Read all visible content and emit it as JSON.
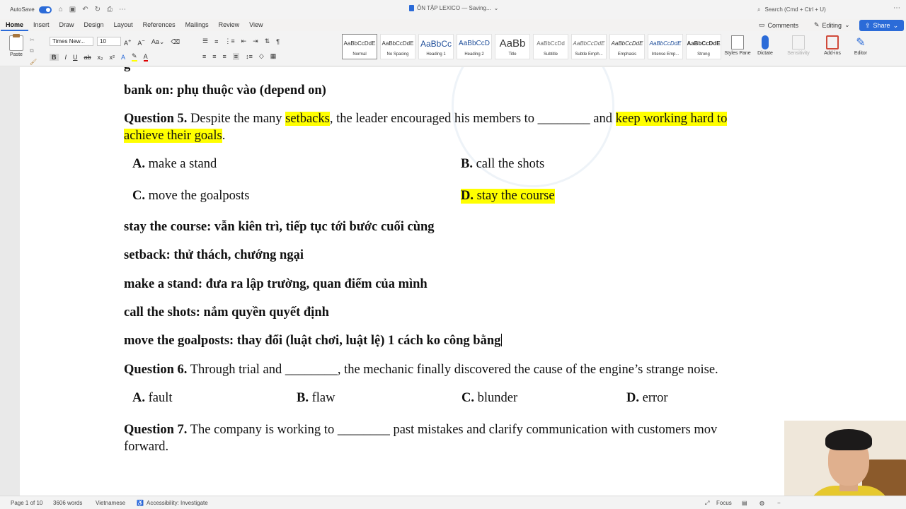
{
  "titlebar": {
    "autosave_label": "AutoSave",
    "document_title": "ÔN TẬP LEXICO — Saving...",
    "search_placeholder": "Search (Cmd + Ctrl + U)"
  },
  "ribbon_tabs": [
    "Home",
    "Insert",
    "Draw",
    "Design",
    "Layout",
    "References",
    "Mailings",
    "Review",
    "View"
  ],
  "ribbon_actions": {
    "comments": "Comments",
    "editing": "Editing",
    "share": "Share"
  },
  "ribbon": {
    "paste_label": "Paste",
    "font_name": "Times New...",
    "font_size": "10",
    "styles": [
      {
        "preview": "AaBbCcDdE",
        "name": "Normal"
      },
      {
        "preview": "AaBbCcDdE",
        "name": "No Spacing"
      },
      {
        "preview": "AaBbCc",
        "name": "Heading 1"
      },
      {
        "preview": "AaBbCcD",
        "name": "Heading 2"
      },
      {
        "preview": "AaBb",
        "name": "Title"
      },
      {
        "preview": "AaBbCcDd",
        "name": "Subtitle"
      },
      {
        "preview": "AaBbCcDdE",
        "name": "Subtle Emph..."
      },
      {
        "preview": "AaBbCcDdE",
        "name": "Emphasis"
      },
      {
        "preview": "AaBbCcDdE",
        "name": "Intense Emp..."
      },
      {
        "preview": "AaBbCcDdE",
        "name": "Strong"
      }
    ],
    "styles_pane": "Styles Pane",
    "dictate": "Dictate",
    "sensitivity": "Sensitivity",
    "addins": "Add-ins",
    "editor": "Editor"
  },
  "document": {
    "bank_on": "bank on: phụ thuộc vào (depend on)",
    "q5": {
      "label": "Question 5.",
      "text1": " Despite the many ",
      "hl1": "setbacks",
      "text2": ", the leader encouraged his members to ________ and ",
      "hl2": "keep working hard to",
      "hl3": "achieve their goals",
      "text3": ".",
      "options": [
        {
          "letter": "A.",
          "text": " make a stand"
        },
        {
          "letter": "B.",
          "text": " call the shots"
        },
        {
          "letter": "C.",
          "text": " move the goalposts"
        },
        {
          "letter": "D.",
          "text": " stay the course"
        }
      ]
    },
    "notes": [
      "stay the course: vẫn kiên trì, tiếp tục tới bước cuối cùng",
      "setback: thử thách, chướng ngại",
      "make a stand: đưa ra lập trường, quan điểm của mình",
      "call the shots: nắm quyền quyết định",
      "move the goalposts: thay đổi (luật chơi, luật lệ) 1 cách ko công bằng"
    ],
    "q6": {
      "label": "Question 6.",
      "text": " Through trial and ________, the mechanic finally discovered the cause of the engine’s strange noise.",
      "options": [
        {
          "letter": "A.",
          "text": " fault"
        },
        {
          "letter": "B.",
          "text": " flaw"
        },
        {
          "letter": "C.",
          "text": " blunder"
        },
        {
          "letter": "D.",
          "text": " error"
        }
      ]
    },
    "q7": {
      "label": "Question 7.",
      "text": " The company is working to ________ past mistakes and clarify communication with customers mov",
      "text_line2": "forward."
    }
  },
  "statusbar": {
    "page": "Page 1 of 10",
    "words": "3606 words",
    "language": "Vietnamese",
    "accessibility": "Accessibility: Investigate",
    "focus": "Focus"
  },
  "colors": {
    "accent": "#2b6bd8",
    "highlight": "#ffff00"
  }
}
